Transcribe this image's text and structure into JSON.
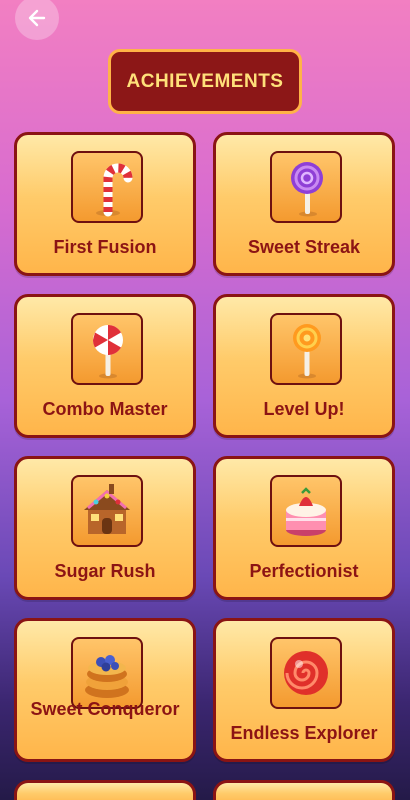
{
  "header": {
    "back_icon": "arrow-left-icon",
    "title": "ACHIEVEMENTS"
  },
  "achievements": [
    {
      "label": "First Fusion",
      "icon": "candy-cane-icon"
    },
    {
      "label": "Sweet Streak",
      "icon": "purple-lollipop-icon"
    },
    {
      "label": "Combo Master",
      "icon": "swirl-lollipop-icon"
    },
    {
      "label": "Level Up!",
      "icon": "orange-lollipop-icon"
    },
    {
      "label": "Sugar Rush",
      "icon": "gingerbread-house-icon"
    },
    {
      "label": "Perfectionist",
      "icon": "strawberry-cake-icon"
    },
    {
      "label": "Sweet Conqueror",
      "icon": "blueberry-pancakes-icon"
    },
    {
      "label": "Endless Explorer",
      "icon": "swirl-candy-icon"
    }
  ],
  "colors": {
    "card_border": "#8a1414",
    "label_text": "#8c1414",
    "title_bg": "#8c1717",
    "title_text": "#ffe07a"
  }
}
